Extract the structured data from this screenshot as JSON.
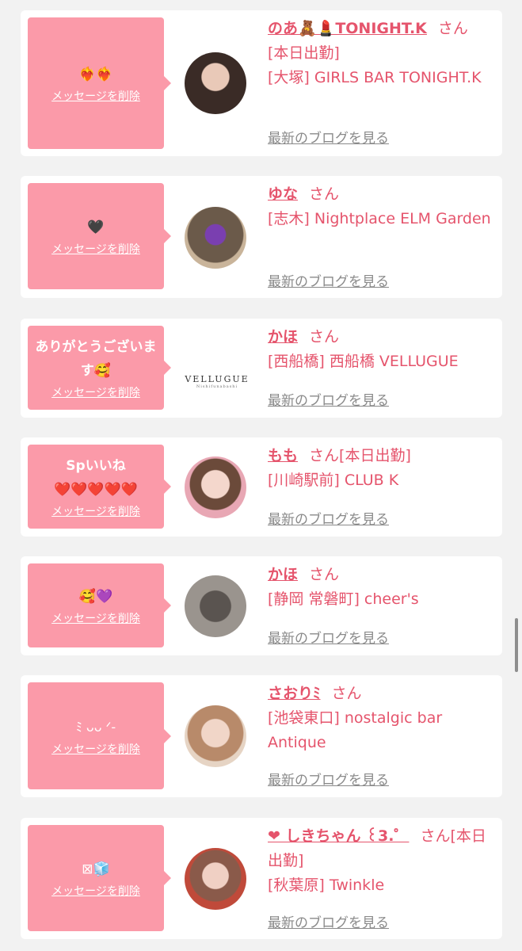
{
  "delete_label": "メッセージを削除",
  "blog_label": "最新のブログを見る",
  "san": "さん",
  "colors": {
    "bubble": "#fb9aa9",
    "accent": "#e5546c",
    "link_gray": "#8a8a8a",
    "background": "#f2f2f2"
  },
  "items": [
    {
      "message": "❤️‍🔥❤️‍🔥",
      "name": "のあ🧸💄TONIGHT.K",
      "status_inline": "",
      "line2": "[本日出勤]",
      "store": "[大塚] GIRLS BAR TONIGHT.K",
      "avatar": "avatar-photo"
    },
    {
      "message": "🖤",
      "name": "ゆな",
      "status_inline": "",
      "line2": "",
      "store": "[志木] Nightplace ELM Garden",
      "avatar": "avatar-photo"
    },
    {
      "message": "ありがとうございます🥰",
      "name": "かほ",
      "status_inline": "",
      "line2": "",
      "store": "[西船橋] 西船橋 VELLUGUE",
      "avatar": "store-logo",
      "logo_text": "VELLUGUE",
      "logo_sub": "Nishifunabashi"
    },
    {
      "message": "Spいいね\n❤️❤️❤️❤️❤️",
      "name": "もも",
      "status_inline": "[本日出勤]",
      "line2": "",
      "store": "[川崎駅前] CLUB K",
      "avatar": "avatar-photo"
    },
    {
      "message": "🥰💜",
      "name": "かほ",
      "status_inline": "",
      "line2": "",
      "store": "[静岡 常磐町] cheer's",
      "avatar": "avatar-photo"
    },
    {
      "message": "ﾐ ᴗᴗ ᐟ-",
      "name": "さおりﾐ",
      "status_inline": "",
      "line2": "",
      "store": "[池袋東口] nostalgic bar Antique",
      "avatar": "avatar-photo"
    },
    {
      "message": "⊠🧊",
      "name": "❤ しきちゃん ꒰3.゜",
      "status_inline": "[本日出勤]",
      "line2": "",
      "store": "[秋葉原] Twinkle",
      "avatar": "avatar-photo"
    }
  ]
}
